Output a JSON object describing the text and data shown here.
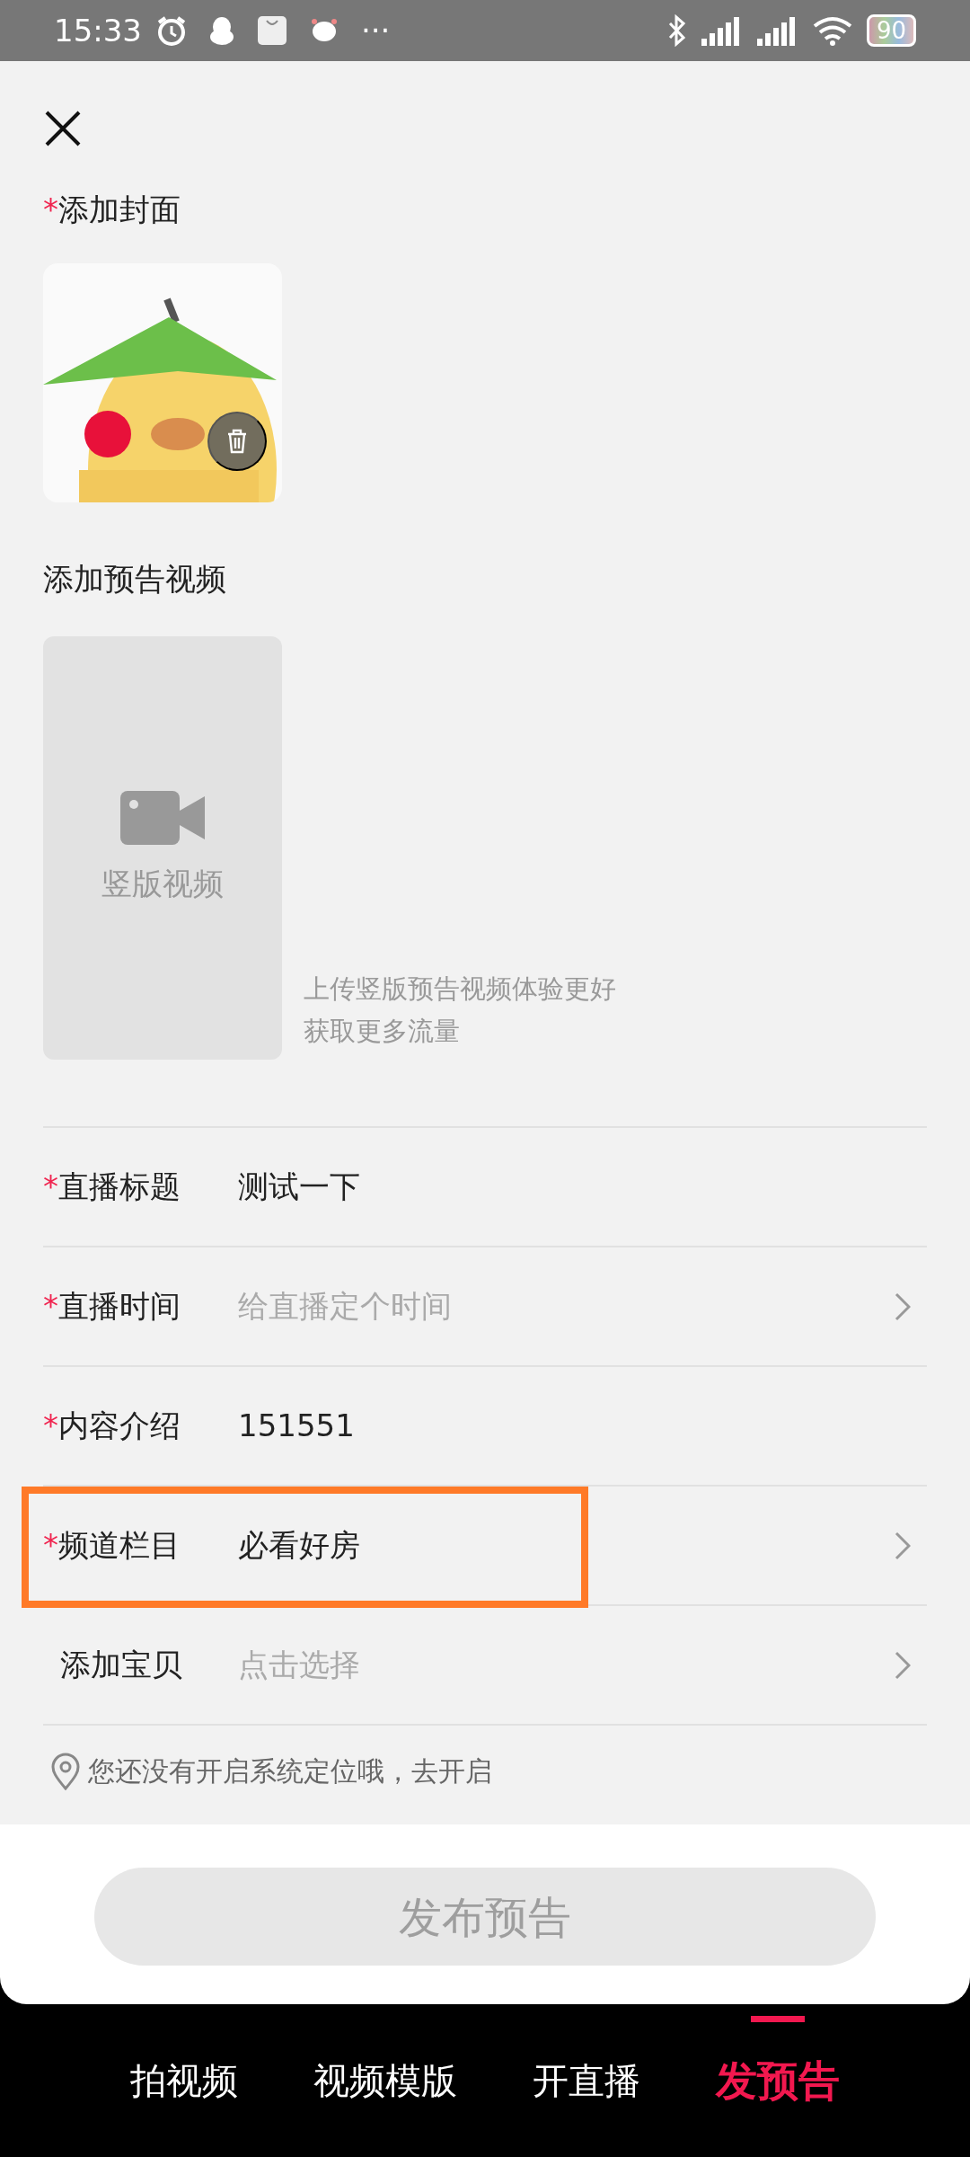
{
  "status_bar": {
    "time": "15:33",
    "more": "···",
    "battery": "90"
  },
  "cover": {
    "label": "添加封面",
    "required_mark": "*",
    "kind": "picture"
  },
  "video": {
    "label": "添加预告视频",
    "placeholder": "竖版视频",
    "hint": [
      "上传竖版预告视频体验更好",
      "获取更多流量"
    ]
  },
  "fields": [
    {
      "label": "直播标题",
      "required_mark": "*",
      "value": "测试一下",
      "chevron": false,
      "highlighted": false
    },
    {
      "label": "直播时间",
      "required_mark": "*",
      "placeholder": "给直播定个时间",
      "chevron": true,
      "highlighted": false
    },
    {
      "label": "内容介绍",
      "required_mark": "*",
      "value": "151551",
      "chevron": false,
      "highlighted": false
    },
    {
      "label": "频道栏目",
      "required_mark": "*",
      "value": "必看好房",
      "chevron": true,
      "highlighted": true
    },
    {
      "label": "添加宝贝",
      "placeholder": "点击选择",
      "chevron": true,
      "highlighted": false
    }
  ],
  "location_notice": "您还没有开启系统定位哦，去开启",
  "publish_button": {
    "label": "发布预告",
    "disabled": true
  },
  "tabs": [
    {
      "label": "拍视频",
      "selected": false
    },
    {
      "label": "视频模版",
      "selected": false
    },
    {
      "label": "开直播",
      "selected": false
    },
    {
      "label": "发预告",
      "selected": true
    }
  ]
}
